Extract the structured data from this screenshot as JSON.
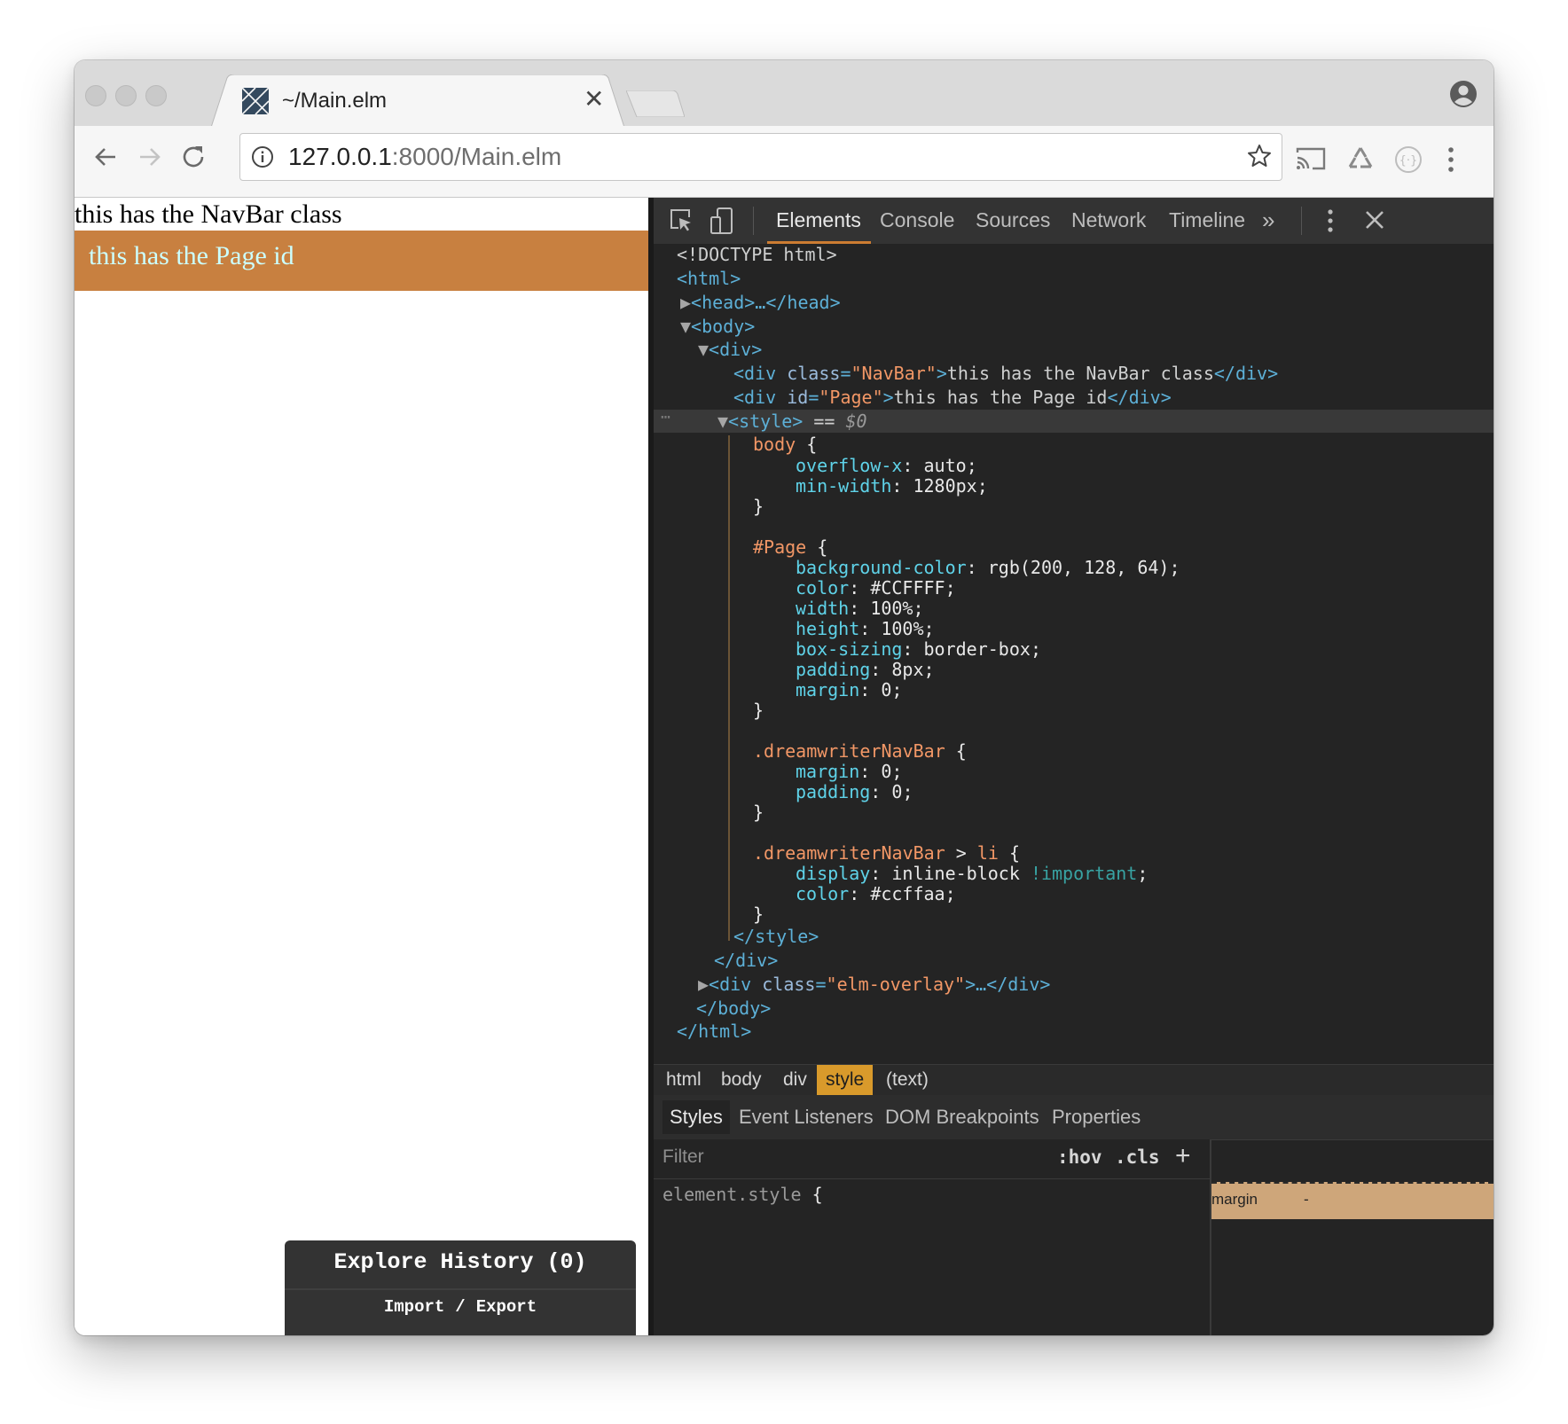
{
  "browser": {
    "tab_title": "~/Main.elm",
    "url_host": "127.0.0.1",
    "url_rest": ":8000/Main.elm"
  },
  "page": {
    "navbar_text": "this has the NavBar class",
    "page_text": "this has the Page id",
    "history_title": "Explore History (0)",
    "history_import": "Import",
    "history_sep": "/",
    "history_export": "Export"
  },
  "devtools": {
    "tabs": [
      "Elements",
      "Console",
      "Sources",
      "Network",
      "Timeline"
    ],
    "more": "»",
    "dom": {
      "doctype": "<!DOCTYPE html>",
      "html_open": "<html>",
      "head": "<head>…</head>",
      "body_open": "<body>",
      "div_open": "<div>",
      "navbar_div": {
        "open": "<div ",
        "attr": "class",
        "eq": "=",
        "val": "\"NavBar\"",
        "close": ">",
        "text": "this has the NavBar class",
        "end": "</div>"
      },
      "page_div": {
        "open": "<div ",
        "attr": "id",
        "eq": "=",
        "val": "\"Page\"",
        "close": ">",
        "text": "this has the Page id",
        "end": "</div>"
      },
      "style_open": "<style>",
      "style_eq": " == ",
      "style_ref": "$0",
      "css": {
        "body_sel": "body",
        "page_sel": "#Page",
        "nav_sel": ".dreamwriterNavBar",
        "nav_li_sel": ".dreamwriterNavBar",
        "nav_li_rest": "li",
        "open_brace": " {",
        "close_brace": "}",
        "body_props": [
          {
            "name": "overflow-x",
            "value": "auto"
          },
          {
            "name": "min-width",
            "value": "1280px"
          }
        ],
        "page_props": [
          {
            "name": "background-color",
            "value": "rgb(200, 128, 64)"
          },
          {
            "name": "color",
            "value": "#CCFFFF"
          },
          {
            "name": "width",
            "value": "100%"
          },
          {
            "name": "height",
            "value": "100%"
          },
          {
            "name": "box-sizing",
            "value": "border-box"
          },
          {
            "name": "padding",
            "value": "8px"
          },
          {
            "name": "margin",
            "value": "0"
          }
        ],
        "nav_props": [
          {
            "name": "margin",
            "value": "0"
          },
          {
            "name": "padding",
            "value": "0"
          }
        ],
        "nav_li_props": [
          {
            "name": "display",
            "value": "inline-block",
            "important": "!important"
          },
          {
            "name": "color",
            "value": "#ccffaa"
          }
        ]
      },
      "style_close": "</style>",
      "div_close": "</div>",
      "overlay_div": {
        "open": "<div ",
        "attr": "class",
        "eq": "=",
        "val": "\"elm-overlay\"",
        "close": ">…</div>"
      },
      "body_close": "</body>",
      "html_close": "</html>"
    },
    "breadcrumbs": [
      "html",
      "body",
      "div",
      "style",
      "(text)"
    ],
    "active_breadcrumb": "style",
    "subtabs": [
      "Styles",
      "Event Listeners",
      "DOM Breakpoints",
      "Properties"
    ],
    "filter_placeholder": "Filter",
    "hov": ":hov",
    "cls": ".cls",
    "plus": "+",
    "element_style": "element.style",
    "boxmodel_label": "margin",
    "boxmodel_value": "-"
  },
  "colors": {
    "page_bg": "#c88040",
    "page_text": "#CCFFFF",
    "accent_orange": "#cc7c32",
    "crumb_active": "#d99a2b",
    "devtools_bg": "#242424"
  }
}
